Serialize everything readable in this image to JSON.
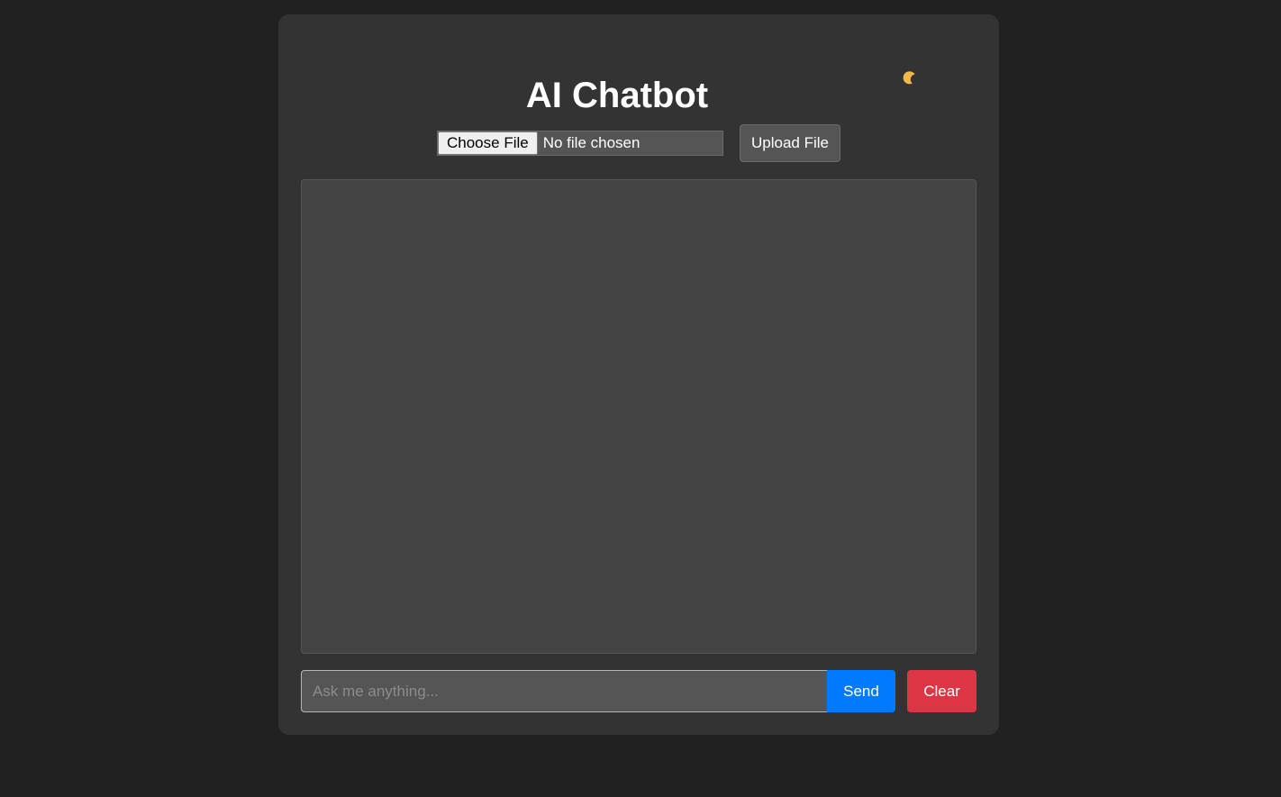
{
  "header": {
    "title": "AI Chatbot",
    "theme_toggle_icon": "moon-icon",
    "theme_toggle_color": "#f5b94a"
  },
  "file_upload": {
    "choose_label": "Choose File",
    "status": "No file chosen",
    "upload_label": "Upload File"
  },
  "chat": {
    "messages": []
  },
  "composer": {
    "placeholder": "Ask me anything...",
    "value": "",
    "send_label": "Send",
    "clear_label": "Clear"
  },
  "colors": {
    "page_bg": "#212121",
    "card_bg": "#333333",
    "chat_bg": "#444444",
    "send": "#007bff",
    "clear": "#dc3545"
  }
}
